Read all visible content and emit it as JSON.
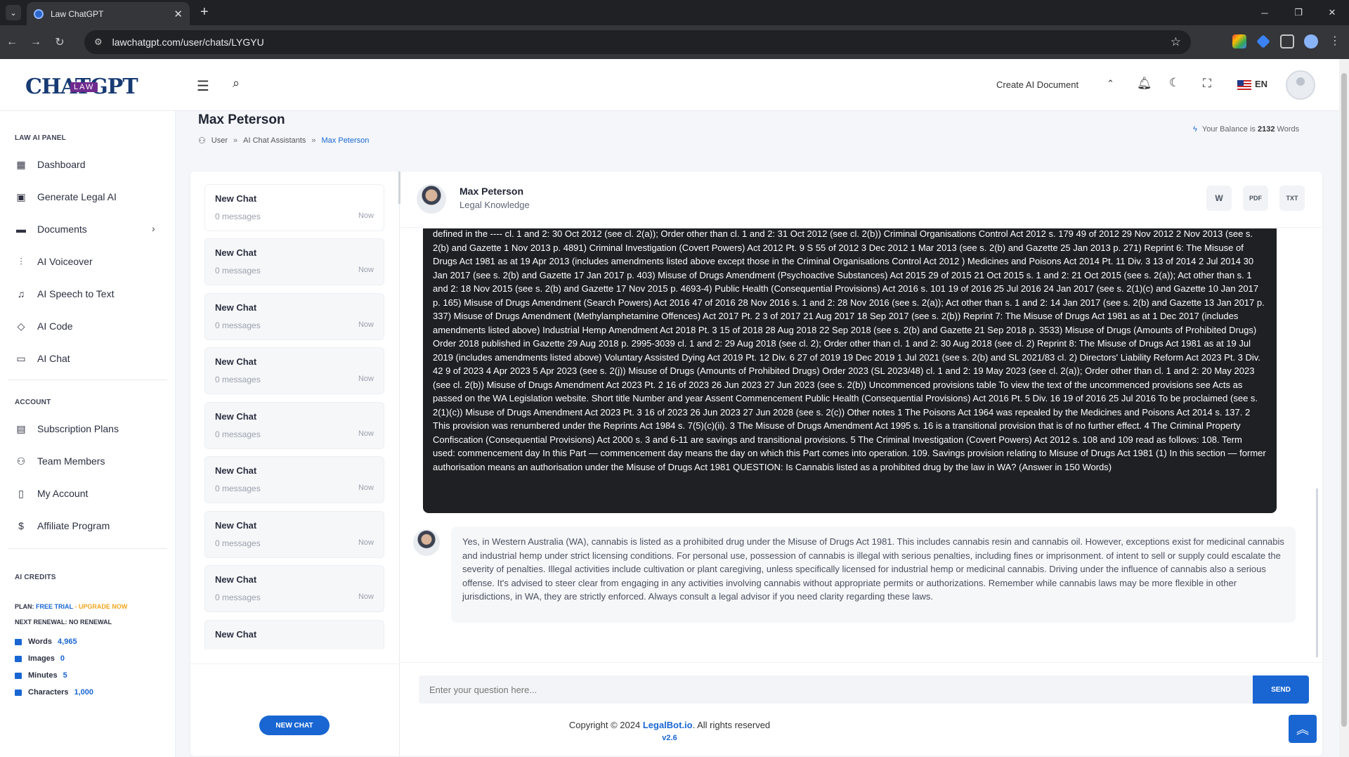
{
  "browser": {
    "tab_title": "Law ChatGPT",
    "url": "lawchatgpt.com/user/chats/LYGYU"
  },
  "topbar": {
    "logo_text": "CHATGPT",
    "logo_badge": "LAW",
    "create_label": "Create AI Document",
    "lang": "EN"
  },
  "sidebar": {
    "panel_heading": "LAW AI PANEL",
    "items": [
      {
        "label": "Dashboard",
        "icon": "dashboard-icon"
      },
      {
        "label": "Generate Legal AI",
        "icon": "ai-chip-icon"
      },
      {
        "label": "Documents",
        "icon": "folder-icon"
      },
      {
        "label": "AI Voiceover",
        "icon": "waveform-icon"
      },
      {
        "label": "AI Speech to Text",
        "icon": "speech-text-icon"
      },
      {
        "label": "AI Code",
        "icon": "code-icon"
      },
      {
        "label": "AI Chat",
        "icon": "chat-icon"
      }
    ],
    "account_heading": "ACCOUNT",
    "account_items": [
      {
        "label": "Subscription Plans",
        "icon": "subscription-icon"
      },
      {
        "label": "Team Members",
        "icon": "team-icon"
      },
      {
        "label": "My Account",
        "icon": "account-icon"
      },
      {
        "label": "Affiliate Program",
        "icon": "dollar-icon"
      }
    ],
    "credits_heading": "AI CREDITS",
    "plan_label": "PLAN:",
    "plan_value": "FREE TRIAL",
    "plan_sep": " - ",
    "upgrade": "UPGRADE NOW",
    "renewal": "NEXT RENEWAL: NO RENEWAL",
    "credits": [
      {
        "label": "Words",
        "value": "4,965"
      },
      {
        "label": "Images",
        "value": "0"
      },
      {
        "label": "Minutes",
        "value": "5"
      },
      {
        "label": "Characters",
        "value": "1,000"
      }
    ]
  },
  "header": {
    "title": "Max Peterson",
    "breadcrumb": [
      "User",
      "AI Chat Assistants",
      "Max Peterson"
    ],
    "breadcrumb_sep": "»",
    "balance_prefix": "Your Balance is",
    "balance_value": "2132",
    "balance_suffix": "Words"
  },
  "chat_list": {
    "items": [
      {
        "name": "New Chat",
        "messages": "0 messages",
        "time": "Now"
      },
      {
        "name": "New Chat",
        "messages": "0 messages",
        "time": "Now"
      },
      {
        "name": "New Chat",
        "messages": "0 messages",
        "time": "Now"
      },
      {
        "name": "New Chat",
        "messages": "0 messages",
        "time": "Now"
      },
      {
        "name": "New Chat",
        "messages": "0 messages",
        "time": "Now"
      },
      {
        "name": "New Chat",
        "messages": "0 messages",
        "time": "Now"
      },
      {
        "name": "New Chat",
        "messages": "0 messages",
        "time": "Now"
      },
      {
        "name": "New Chat",
        "messages": "0 messages",
        "time": "Now"
      },
      {
        "name": "New Chat",
        "messages": "",
        "time": ""
      }
    ],
    "new_chat_label": "NEW CHAT"
  },
  "conversation": {
    "assistant_name": "Max Peterson",
    "assistant_role": "Legal Knowledge",
    "user_message": "defined in the ---- cl. 1 and 2: 30 Oct 2012 (see cl. 2(a)); Order other than cl. 1 and 2: 31 Oct 2012 (see cl. 2(b)) Criminal Organisations Control Act 2012 s. 179 49 of 2012 29 Nov 2012 2 Nov 2013 (see s. 2(b) and Gazette 1 Nov 2013 p. 4891) Criminal Investigation (Covert Powers) Act 2012 Pt. 9 S 55 of 2012 3 Dec 2012 1 Mar 2013 (see s. 2(b) and Gazette 25 Jan 2013 p. 271) Reprint 6: The Misuse of Drugs Act 1981 as at 19 Apr 2013 (includes amendments listed above except those in the Criminal Organisations Control Act 2012 ) Medicines and Poisons Act 2014 Pt. 11 Div. 3 13 of 2014 2 Jul 2014 30 Jan 2017 (see s. 2(b) and Gazette 17 Jan 2017 p. 403) Misuse of Drugs Amendment (Psychoactive Substances) Act 2015 29 of 2015 21 Oct 2015 s. 1 and 2: 21 Oct 2015 (see s. 2(a)); Act other than s. 1 and 2: 18 Nov 2015 (see s. 2(b) and Gazette 17 Nov 2015 p. 4693-4) Public Health (Consequential Provisions) Act 2016 s. 101 19 of 2016 25 Jul 2016 24 Jan 2017 (see s. 2(1)(c) and Gazette 10 Jan 2017 p. 165) Misuse of Drugs Amendment (Search Powers) Act 2016 47 of 2016 28 Nov 2016 s. 1 and 2: 28 Nov 2016 (see s. 2(a)); Act other than s. 1 and 2: 14 Jan 2017 (see s. 2(b) and Gazette 13 Jan 2017 p. 337) Misuse of Drugs Amendment (Methylamphetamine Offences) Act 2017 Pt. 2 3 of 2017 21 Aug 2017 18 Sep 2017 (see s. 2(b)) Reprint 7: The Misuse of Drugs Act 1981 as at 1 Dec 2017 (includes amendments listed above) Industrial Hemp Amendment Act 2018 Pt. 3 15 of 2018 28 Aug 2018 22 Sep 2018 (see s. 2(b) and Gazette 21 Sep 2018 p. 3533) Misuse of Drugs (Amounts of Prohibited Drugs) Order 2018 published in Gazette 29 Aug 2018 p. 2995-3039 cl. 1 and 2: 29 Aug 2018 (see cl. 2); Order other than cl. 1 and 2: 30 Aug 2018 (see cl. 2) Reprint 8: The Misuse of Drugs Act 1981 as at 19 Jul 2019 (includes amendments listed above) Voluntary Assisted Dying Act 2019 Pt. 12 Div. 6 27 of 2019 19 Dec 2019 1 Jul 2021 (see s. 2(b) and SL 2021/83 cl. 2) Directors' Liability Reform Act 2023 Pt. 3 Div. 42 9 of 2023 4 Apr 2023 5 Apr 2023 (see s. 2(j)) Misuse of Drugs (Amounts of Prohibited Drugs) Order 2023 (SL 2023/48) cl. 1 and 2: 19 May 2023 (see cl. 2(a)); Order other than cl. 1 and 2: 20 May 2023 (see cl. 2(b)) Misuse of Drugs Amendment Act 2023 Pt. 2 16 of 2023 26 Jun 2023 27 Jun 2023 (see s. 2(b)) Uncommenced provisions table To view the text of the uncommenced provisions see Acts as passed on the WA Legislation website. Short title Number and year Assent Commencement Public Health (Consequential Provisions) Act 2016 Pt. 5 Div. 16 19 of 2016 25 Jul 2016 To be proclaimed (see s. 2(1)(c)) Misuse of Drugs Amendment Act 2023 Pt. 3 16 of 2023 26 Jun 2023 27 Jun 2028 (see s. 2(c)) Other notes 1 The Poisons Act 1964 was repealed by the Medicines and Poisons Act 2014 s. 137. 2 This provision was renumbered under the Reprints Act 1984 s. 7(5)(c)(ii). 3 The Misuse of Drugs Amendment Act 1995 s. 16 is a transitional provision that is of no further effect. 4 The Criminal Property Confiscation (Consequential Provisions) Act 2000 s. 3 and 6-11 are savings and transitional provisions. 5 The Criminal Investigation (Covert Powers) Act 2012 s. 108 and 109 read as follows: 108. Term used: commencement day In this Part — commencement day means the day on which this Part comes into operation. 109. Savings provision relating to Misuse of Drugs Act 1981 (1) In this section — former authorisation means an authorisation under the Misuse of Drugs Act 1981 QUESTION: Is Cannabis listed as a prohibited drug by the law in WA? (Answer in 150 Words)",
    "bot_message": "Yes, in Western Australia (WA), cannabis is listed as a prohibited drug under the Misuse of Drugs Act 1981. This includes cannabis resin and cannabis oil. However, exceptions exist for medicinal cannabis and industrial hemp under strict licensing conditions. For personal use, possession of cannabis is illegal with serious penalties, including fines or imprisonment. of intent to sell or supply could escalate the severity of penalties. Illegal activities include cultivation or plant caregiving, unless specifically licensed for industrial hemp or medicinal cannabis. Driving under the influence of cannabis also a serious offense. It's advised to steer clear from engaging in any activities involving cannabis without appropriate permits or authorizations. Remember while cannabis laws may be more flexible in other jurisdictions, in WA, they are strictly enforced. Always consult a legal advisor if you need clarity regarding these laws.",
    "input_placeholder": "Enter your question here...",
    "send_label": "SEND",
    "download_buttons": [
      "W",
      "PDF",
      "TXT"
    ]
  },
  "footer": {
    "copyright_prefix": "Copyright © 2024",
    "brand": "LegalBot.io",
    "copyright_suffix": ". All rights reserved",
    "version": "v2.6"
  },
  "colors": {
    "accent": "#1966d2",
    "upgrade": "#f0a51c",
    "user_bubble": "#1f2024",
    "bot_bubble": "#f6f7f9"
  }
}
